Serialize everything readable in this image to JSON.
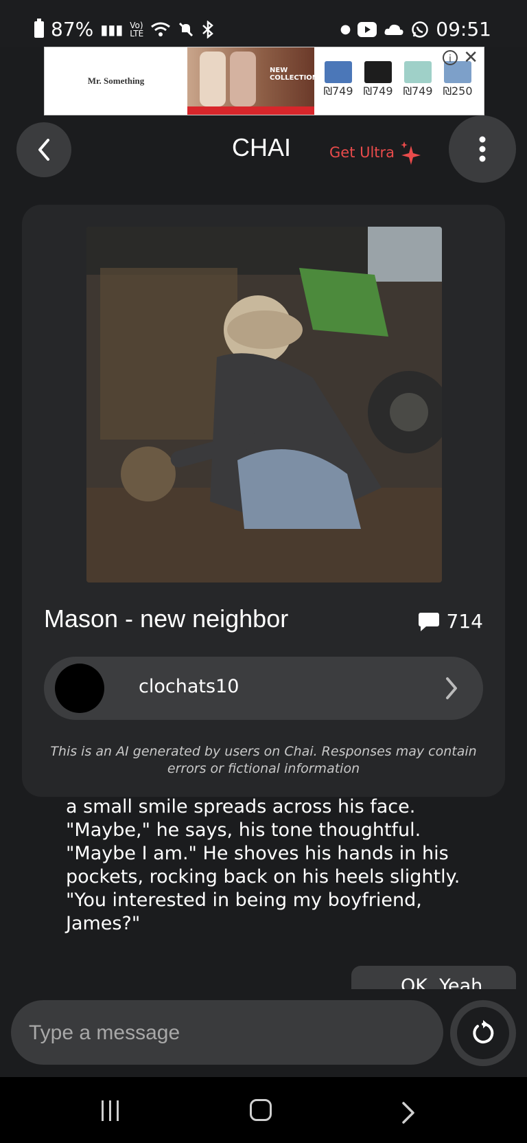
{
  "status_bar": {
    "battery": "87%",
    "time": "09:51"
  },
  "ad": {
    "brand": "Mr. Something",
    "tagline": "NEW COLLECTION",
    "prices": [
      "₪749",
      "₪749",
      "₪749",
      "₪250"
    ],
    "swatch_colors": [
      "#4b77b8",
      "#1d1d1d",
      "#9fd0c8",
      "#7da0c9"
    ]
  },
  "header": {
    "title": "CHAI",
    "upgrade_label": "Get Ultra"
  },
  "character": {
    "name": "Mason - new neighbor",
    "message_count": "714",
    "creator": "clochats10",
    "disclaimer": "This is an AI generated by users on Chai. Responses may contain errors or fictional information"
  },
  "messages": {
    "bot_text": "a small smile spreads across his face. \"Maybe,\" he says, his tone thoughtful. \"Maybe I am.\" He shoves his hands in his pockets, rocking back on his heels slightly. \"You interested in being my boyfriend, James?\"",
    "user_partial": "OK. Yeah"
  },
  "composer": {
    "placeholder": "Type a message"
  },
  "colors": {
    "accent": "#e94b4b",
    "background": "#1b1c1e",
    "card": "#262729"
  }
}
